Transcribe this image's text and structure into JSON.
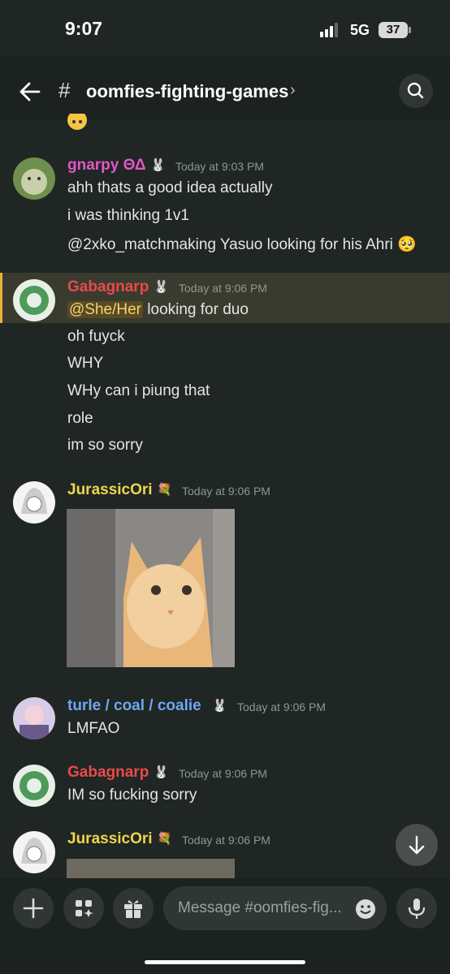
{
  "status": {
    "time": "9:07",
    "network": "5G",
    "battery": "37"
  },
  "header": {
    "channel": "oomfies-fighting-games"
  },
  "messages": [
    {
      "author": "gnarpy ΘΔ",
      "badge": "🐰",
      "time": "Today at 9:03 PM",
      "color": "#e357c9",
      "lines": [
        "ahh thats a good idea actually",
        "i was thinking 1v1",
        "@2xko_matchmaking Yasuo looking for his Ahri 🥺"
      ]
    },
    {
      "author": "Gabagnarp",
      "badge": "🐰",
      "time": "Today at 9:06 PM",
      "color": "#e84a4a",
      "mention": "@She/Her",
      "mention_rest": " looking for duo",
      "lines": [
        "oh fuyck",
        "WHY",
        "WHy can i piung that",
        "role",
        "im so sorry"
      ]
    },
    {
      "author": "JurassicOri",
      "badge": "💐",
      "time": "Today at 9:06 PM",
      "color": "#f0d54a"
    },
    {
      "author": "turle / coal / coalie",
      "badge": "🐰",
      "time": "Today at 9:06 PM",
      "color": "#6ea6f0",
      "lines": [
        "LMFAO"
      ]
    },
    {
      "author": "Gabagnarp",
      "badge": "🐰",
      "time": "Today at 9:06 PM",
      "color": "#e84a4a",
      "lines": [
        "IM so fucking sorry"
      ]
    },
    {
      "author": "JurassicOri",
      "badge": "💐",
      "time": "Today at 9:06 PM",
      "color": "#f0d54a"
    }
  ],
  "composer": {
    "placeholder": "Message #oomfies-fig..."
  }
}
